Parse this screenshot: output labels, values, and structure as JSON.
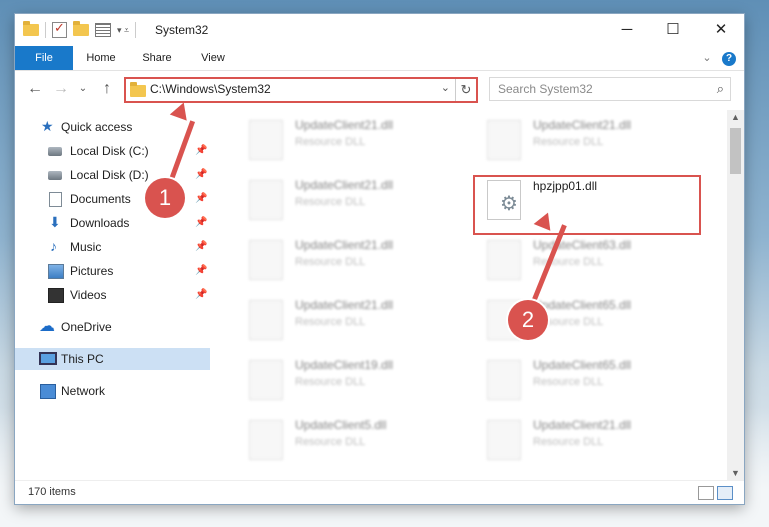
{
  "window": {
    "title": "System32",
    "minimize_icon": "minimize-icon",
    "maximize_icon": "maximize-icon",
    "close_icon": "close-icon"
  },
  "ribbon": {
    "tabs": [
      "File",
      "Home",
      "Share",
      "View"
    ]
  },
  "navigation": {
    "address": "C:\\Windows\\System32",
    "search_placeholder": "Search System32"
  },
  "sidebar": {
    "items": [
      {
        "label": "Quick access",
        "icon": "star-icon"
      },
      {
        "label": "Local Disk (C:)",
        "icon": "disk-icon",
        "pinned": true
      },
      {
        "label": "Local Disk (D:)",
        "icon": "disk-icon",
        "pinned": true
      },
      {
        "label": "Documents",
        "icon": "documents-icon",
        "pinned": true
      },
      {
        "label": "Downloads",
        "icon": "downloads-icon",
        "pinned": true
      },
      {
        "label": "Music",
        "icon": "music-icon",
        "pinned": true
      },
      {
        "label": "Pictures",
        "icon": "pictures-icon",
        "pinned": true
      },
      {
        "label": "Videos",
        "icon": "videos-icon",
        "pinned": true
      },
      {
        "label": "OneDrive",
        "icon": "onedrive-icon"
      },
      {
        "label": "This PC",
        "icon": "this-pc-icon",
        "selected": true
      },
      {
        "label": "Network",
        "icon": "network-icon"
      }
    ]
  },
  "files": {
    "left_column": [
      {
        "name": "UpdateClient21.dll",
        "type": "Resource DLL"
      },
      {
        "name": "UpdateClient21.dll",
        "type": "Resource DLL"
      },
      {
        "name": "UpdateClient21.dll",
        "type": "Resource DLL"
      },
      {
        "name": "UpdateClient21.dll",
        "type": "Resource DLL"
      },
      {
        "name": "UpdateClient19.dll",
        "type": "Resource DLL"
      },
      {
        "name": "UpdateClient5.dll",
        "type": "Resource DLL"
      }
    ],
    "right_column": [
      {
        "name": "UpdateClient21.dll",
        "type": "Resource DLL"
      },
      {
        "name": "UpdateClient63.dll",
        "type": "Resource DLL"
      },
      {
        "name": "UpdateClient65.dll",
        "type": "Resource DLL"
      },
      {
        "name": "UpdateClient65.dll",
        "type": "Resource DLL"
      },
      {
        "name": "UpdateClient21.dll",
        "type": "Resource DLL"
      }
    ],
    "highlighted": {
      "name": "hpzjpp01.dll"
    }
  },
  "status": {
    "item_count": "170 items"
  },
  "callouts": [
    "1",
    "2"
  ],
  "colors": {
    "accent": "#1979ca",
    "callout": "#d9534f",
    "selection": "#cce0f4"
  }
}
